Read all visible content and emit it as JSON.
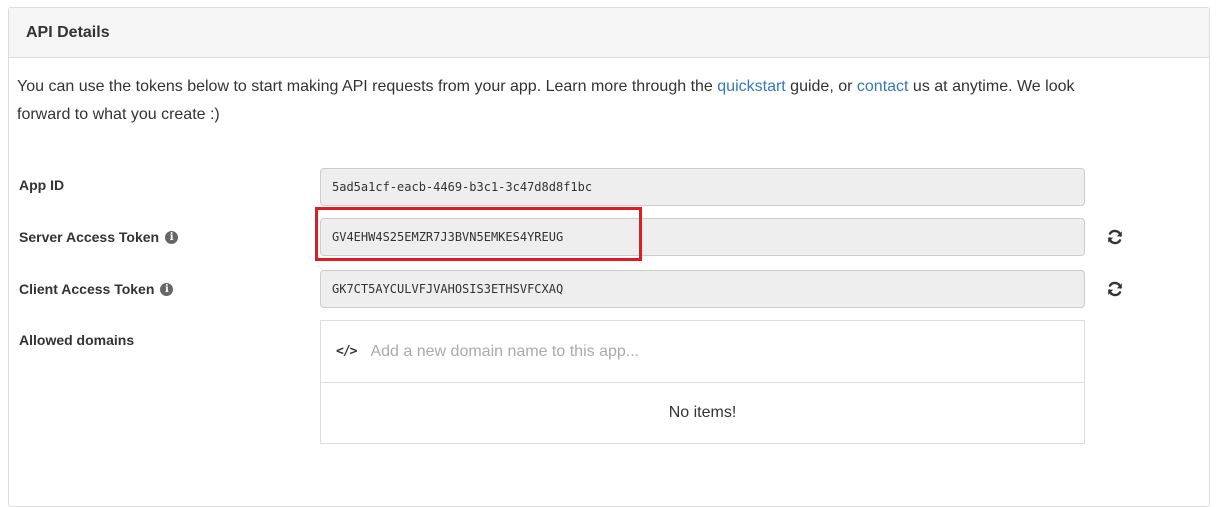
{
  "panel": {
    "title": "API Details"
  },
  "intro": {
    "text_before_quickstart": "You can use the tokens below to start making API requests from your app. Learn more through the ",
    "quickstart_link": "quickstart",
    "text_between": " guide, or ",
    "contact_link": "contact",
    "text_after": " us at anytime. We look forward to what you create :)"
  },
  "fields": {
    "app_id": {
      "label": "App ID",
      "value": "5ad5a1cf-eacb-4469-b3c1-3c47d8d8f1bc"
    },
    "server_token": {
      "label": "Server Access Token",
      "value": "GV4EHW4S25EMZR7J3BVN5EMKES4YREUG"
    },
    "client_token": {
      "label": "Client Access Token",
      "value": "GK7CT5AYCULVFJVAHOSIS3ETHSVFCXAQ"
    }
  },
  "domains": {
    "label": "Allowed domains",
    "placeholder": "Add a new domain name to this app...",
    "icon": "code-icon",
    "empty_text": "No items!"
  },
  "colors": {
    "link": "#337ab7",
    "highlight": "#e01b24"
  }
}
